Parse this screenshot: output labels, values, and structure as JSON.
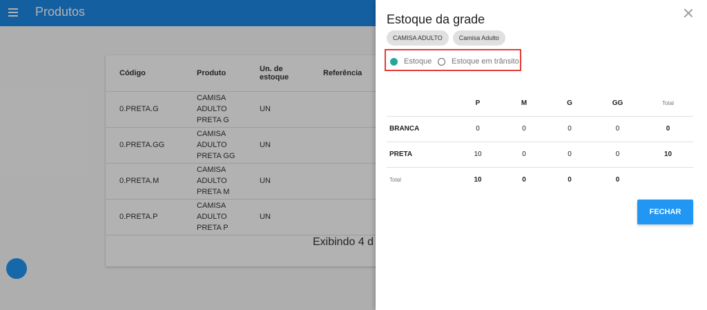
{
  "appbar": {
    "title": "Produtos"
  },
  "table": {
    "headers": [
      "Código",
      "Produto",
      "Un. de estoque",
      "Referência"
    ],
    "rows": [
      [
        "0.PRETA.G",
        "CAMISA ADULTO PRETA G",
        "UN",
        ""
      ],
      [
        "0.PRETA.GG",
        "CAMISA ADULTO PRETA GG",
        "UN",
        ""
      ],
      [
        "0.PRETA.M",
        "CAMISA ADULTO PRETA M",
        "UN",
        ""
      ],
      [
        "0.PRETA.P",
        "CAMISA ADULTO PRETA P",
        "UN",
        ""
      ]
    ],
    "footer": "Exibindo 4 d"
  },
  "panel": {
    "title": "Estoque da grade",
    "chips": [
      "CAMISA ADULTO",
      "Camisa Adulto"
    ],
    "radios": [
      {
        "label": "Estoque",
        "selected": true
      },
      {
        "label": "Estoque em trânsito",
        "selected": false
      }
    ],
    "grid": {
      "columns": [
        "P",
        "M",
        "G",
        "GG"
      ],
      "total_label": "Total",
      "rows": [
        {
          "name": "BRANCA",
          "values": [
            "0",
            "0",
            "0",
            "0"
          ],
          "total": "0"
        },
        {
          "name": "PRETA",
          "values": [
            "10",
            "0",
            "0",
            "0"
          ],
          "total": "10"
        }
      ],
      "totals": [
        "10",
        "0",
        "0",
        "0"
      ]
    },
    "close_button": "FECHAR"
  },
  "colors": {
    "appbar": "#1e88e5",
    "primary_button": "#2196f3",
    "radio_selected": "#26a69a",
    "highlight_border": "#e53935"
  },
  "icons": {
    "menu": "menu-icon",
    "close": "close-icon"
  }
}
